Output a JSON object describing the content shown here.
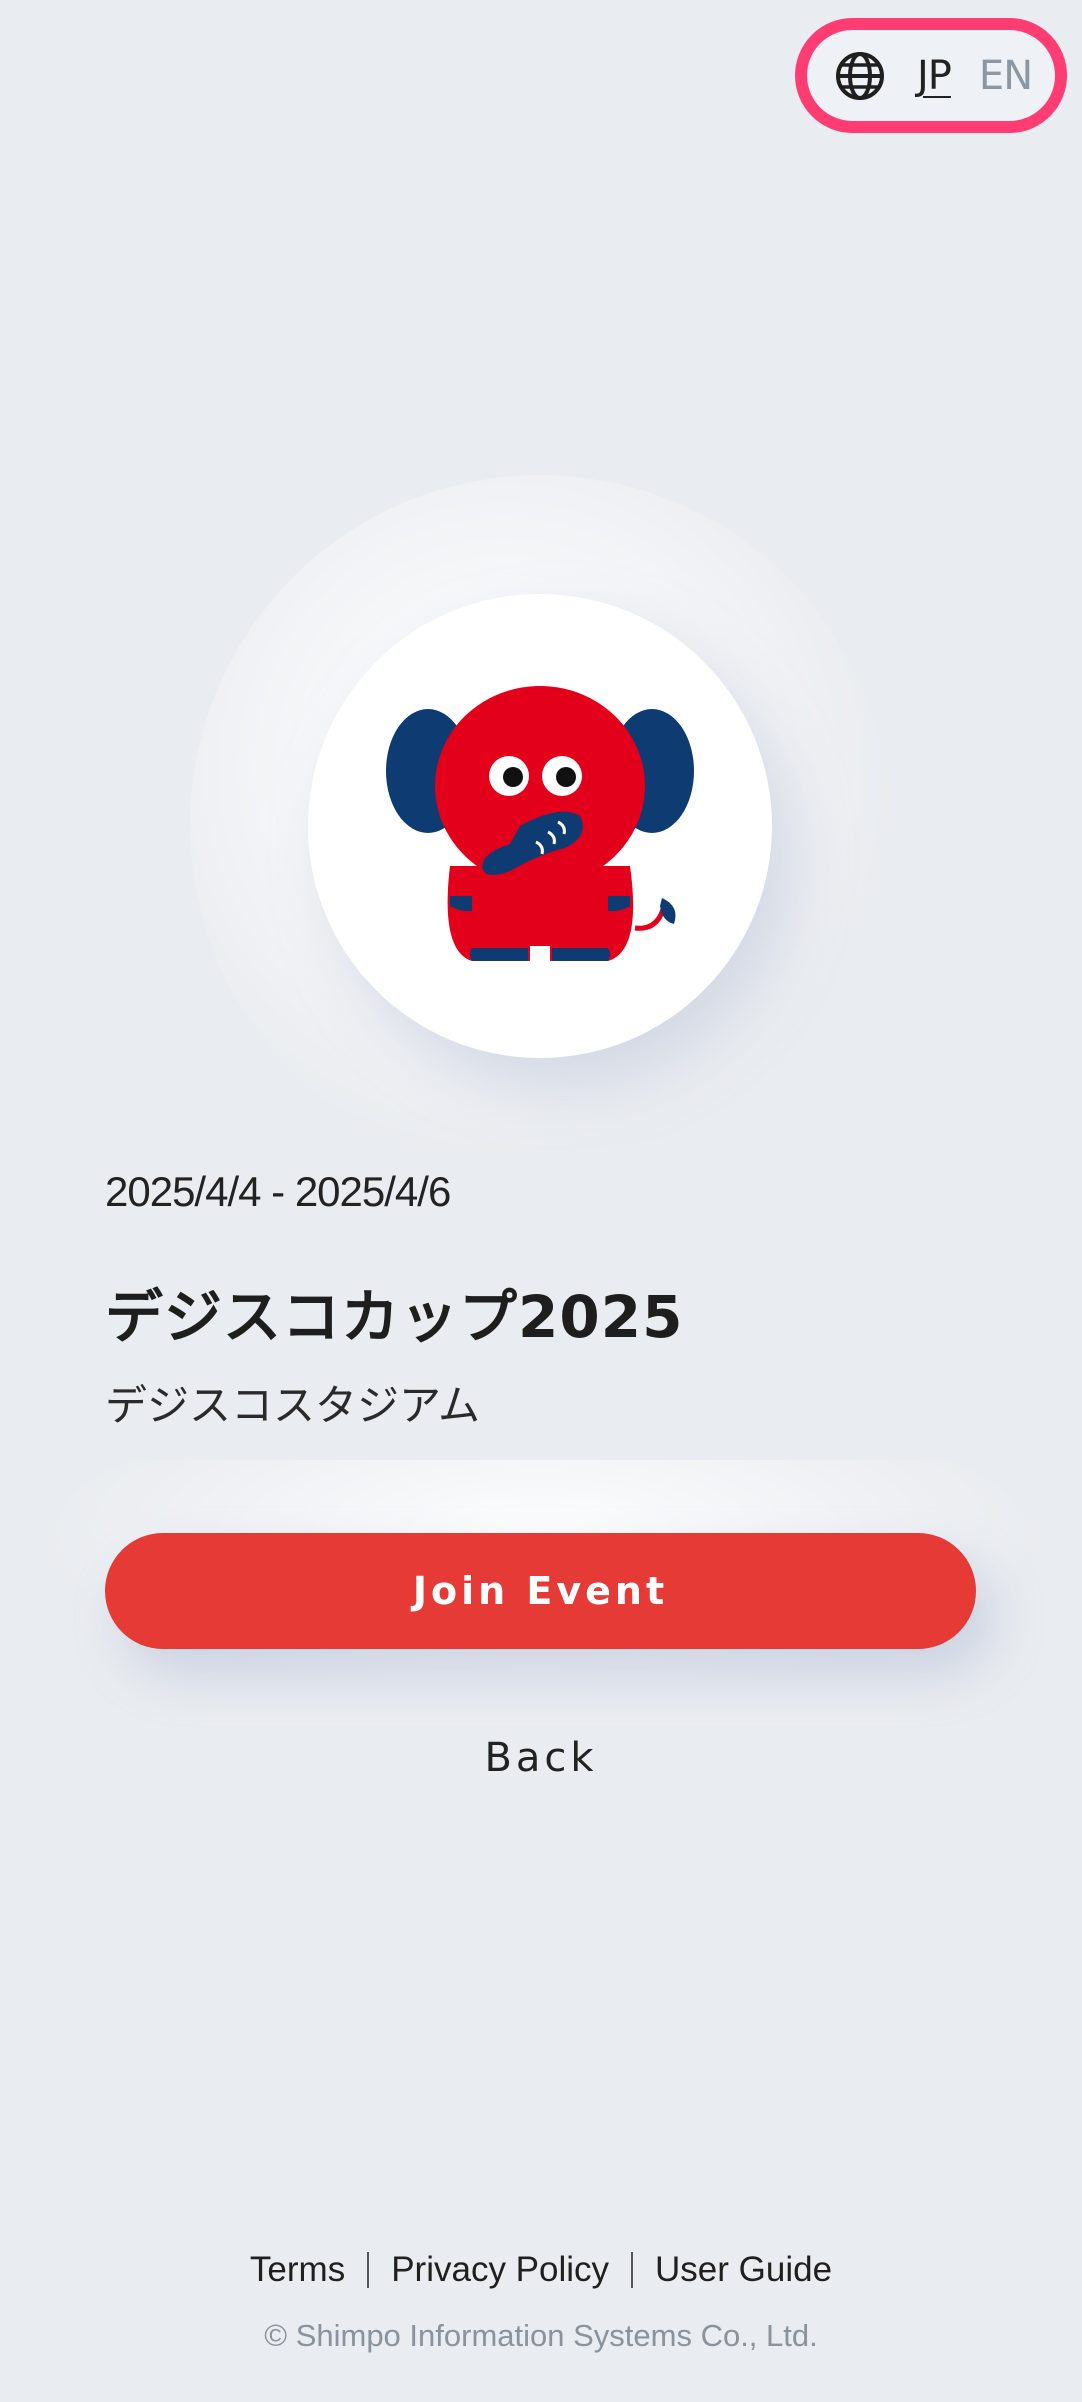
{
  "language": {
    "icon": "globe-icon",
    "options": [
      "JP",
      "EN"
    ],
    "selected": "JP"
  },
  "event": {
    "logo_icon": "elephant-mascot",
    "date_range": "2025/4/4 - 2025/4/6",
    "title": "デジスコカップ2025",
    "venue": "デジスコスタジアム"
  },
  "actions": {
    "join_label": "Join Event",
    "back_label": "Back"
  },
  "footer": {
    "links": [
      "Terms",
      "Privacy Policy",
      "User Guide"
    ],
    "copyright": "© Shimpo Information Systems Co., Ltd."
  },
  "colors": {
    "accent": "#e53a36",
    "highlight_ring": "#ff3d73",
    "background": "#e9ecf0",
    "mascot_red": "#e2001a",
    "mascot_navy": "#0e3b72"
  }
}
